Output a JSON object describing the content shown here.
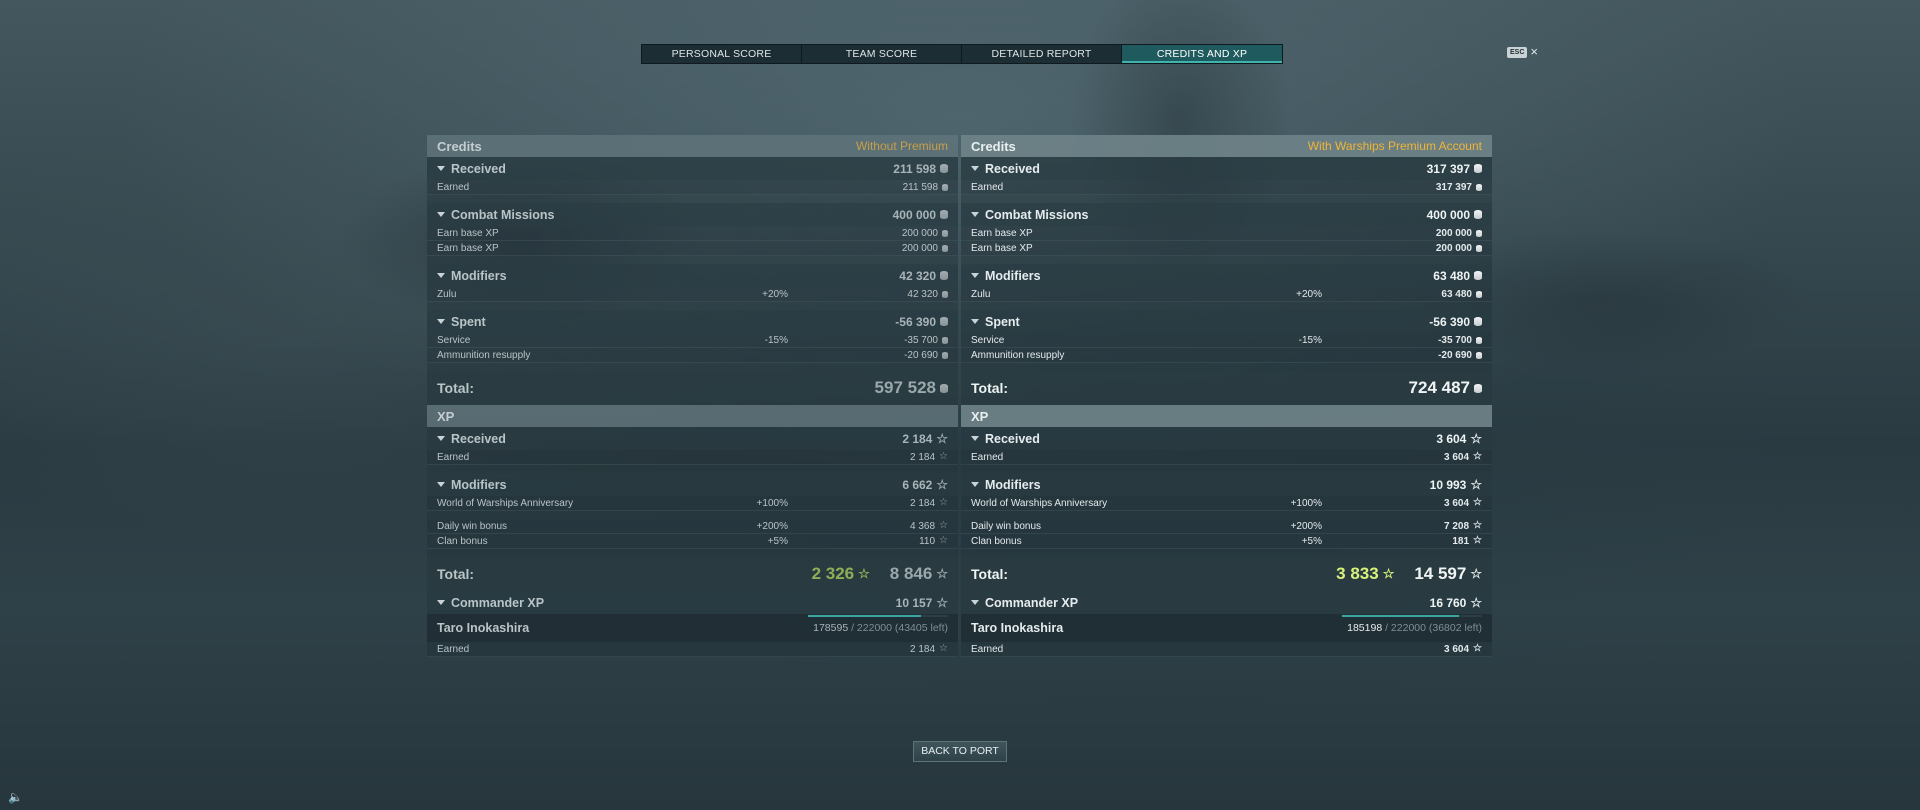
{
  "tabs": [
    {
      "label": "PERSONAL SCORE"
    },
    {
      "label": "TEAM SCORE"
    },
    {
      "label": "DETAILED REPORT"
    },
    {
      "label": "CREDITS AND XP"
    }
  ],
  "esc": {
    "key": "ESC",
    "close": "×"
  },
  "left": {
    "credits_title": "Credits",
    "credits_tag": "Without Premium",
    "received": {
      "label": "Received",
      "value": "211 598"
    },
    "earned": {
      "label": "Earned",
      "value": "211 598"
    },
    "missions": {
      "label": "Combat Missions",
      "value": "400 000"
    },
    "missions_rows": [
      {
        "label": "Earn base XP",
        "value": "200 000"
      },
      {
        "label": "Earn base XP",
        "value": "200 000"
      }
    ],
    "modifiers": {
      "label": "Modifiers",
      "value": "42 320"
    },
    "zulu": {
      "label": "Zulu",
      "pct": "+20%",
      "value": "42 320"
    },
    "spent": {
      "label": "Spent",
      "value": "-56 390"
    },
    "service": {
      "label": "Service",
      "pct": "-15%",
      "value": "-35 700"
    },
    "ammo": {
      "label": "Ammunition resupply",
      "value": "-20 690"
    },
    "credits_total": {
      "label": "Total:",
      "value": "597 528"
    },
    "xp_title": "XP",
    "xp_received": {
      "label": "Received",
      "value": "2 184"
    },
    "xp_earned": {
      "label": "Earned",
      "value": "2 184"
    },
    "xp_modifiers": {
      "label": "Modifiers",
      "value": "6 662"
    },
    "anniv": {
      "label": "World of Warships Anniversary",
      "pct": "+100%",
      "value": "2 184"
    },
    "daily": {
      "label": "Daily win bonus",
      "pct": "+200%",
      "value": "4 368"
    },
    "clan": {
      "label": "Clan bonus",
      "pct": "+5%",
      "value": "110"
    },
    "xp_total": {
      "label": "Total:",
      "base": "2 326",
      "value": "8 846"
    },
    "commander_xp": {
      "label": "Commander XP",
      "value": "10 157"
    },
    "commander": {
      "name": "Taro Inokashira",
      "current": "178595",
      "rest": "/ 222000 (43405 left)",
      "progress": 0.804
    },
    "commander_earned": {
      "label": "Earned",
      "value": "2 184"
    }
  },
  "right": {
    "credits_title": "Credits",
    "credits_tag": "With Warships Premium Account",
    "received": {
      "label": "Received",
      "value": "317 397"
    },
    "earned": {
      "label": "Earned",
      "value": "317 397"
    },
    "missions": {
      "label": "Combat Missions",
      "value": "400 000"
    },
    "missions_rows": [
      {
        "label": "Earn base XP",
        "value": "200 000"
      },
      {
        "label": "Earn base XP",
        "value": "200 000"
      }
    ],
    "modifiers": {
      "label": "Modifiers",
      "value": "63 480"
    },
    "zulu": {
      "label": "Zulu",
      "pct": "+20%",
      "value": "63 480"
    },
    "spent": {
      "label": "Spent",
      "value": "-56 390"
    },
    "service": {
      "label": "Service",
      "pct": "-15%",
      "value": "-35 700"
    },
    "ammo": {
      "label": "Ammunition resupply",
      "value": "-20 690"
    },
    "credits_total": {
      "label": "Total:",
      "value": "724 487"
    },
    "xp_title": "XP",
    "xp_received": {
      "label": "Received",
      "value": "3 604"
    },
    "xp_earned": {
      "label": "Earned",
      "value": "3 604"
    },
    "xp_modifiers": {
      "label": "Modifiers",
      "value": "10 993"
    },
    "anniv": {
      "label": "World of Warships Anniversary",
      "pct": "+100%",
      "value": "3 604"
    },
    "daily": {
      "label": "Daily win bonus",
      "pct": "+200%",
      "value": "7 208"
    },
    "clan": {
      "label": "Clan bonus",
      "pct": "+5%",
      "value": "181"
    },
    "xp_total": {
      "label": "Total:",
      "base": "3 833",
      "value": "14 597"
    },
    "commander_xp": {
      "label": "Commander XP",
      "value": "16 760"
    },
    "commander": {
      "name": "Taro Inokashira",
      "current": "185198",
      "rest": "/ 222000 (36802 left)",
      "progress": 0.834
    },
    "commander_earned": {
      "label": "Earned",
      "value": "3 604"
    }
  },
  "back_button": "BACK TO PORT",
  "colors": {
    "accent": "#3fb3ac",
    "premium": "#f0b437",
    "base_xp": "#d8f27a"
  }
}
